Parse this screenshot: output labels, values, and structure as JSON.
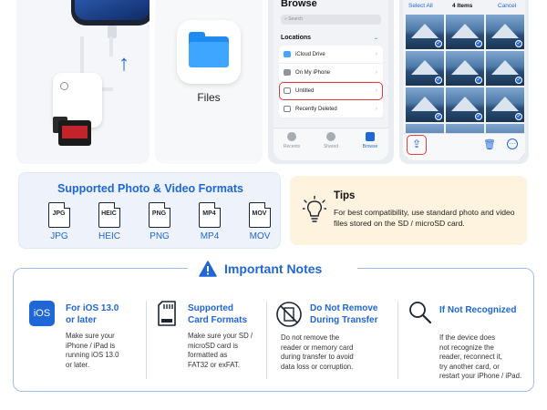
{
  "panel_files": {
    "label": "Files"
  },
  "browse": {
    "title": "Browse",
    "search_placeholder": "Search",
    "locations_header": "Locations",
    "items": [
      "iCloud Drive",
      "On My iPhone",
      "Untitled",
      "Recently Deleted"
    ],
    "tabs": [
      "Recents",
      "Shared",
      "Browse"
    ]
  },
  "photos": {
    "select_all": "Select All",
    "count": "4 Items",
    "cancel": "Cancel"
  },
  "formats": {
    "title": "Supported Photo & Video Formats",
    "items": [
      "JPG",
      "HEIC",
      "PNG",
      "MP4",
      "MOV"
    ]
  },
  "tips": {
    "title": "Tips",
    "text": "For best compatibility, use standard photo and video files stored on the SD / microSD card."
  },
  "notes": {
    "title": "Important Notes",
    "ios_badge": "iOS",
    "cards": [
      {
        "title_1": "For iOS 13.0",
        "title_2": "or later",
        "text_1": "Make sure your",
        "text_2": "iPhone / iPad is",
        "text_3": "running iOS 13.0",
        "text_4": "or later."
      },
      {
        "title_1": "Supported",
        "title_2": "Card Formats",
        "text_1": "Make sure your SD /",
        "text_2": "microSD card is",
        "text_3": "formatted as",
        "text_4": "FAT32 or exFAT."
      },
      {
        "title_1": "Do Not Remove",
        "title_2": "During Transfer",
        "text_1": "Do not remove the",
        "text_2": "reader or memory card",
        "text_3": "during transfer to avoid",
        "text_4": "data loss or corruption."
      },
      {
        "title_1": "If Not Recognized",
        "text_1": "If the device does",
        "text_2": "not recognize the",
        "text_3": "reader, reconnect it,",
        "text_4": "try another card, or",
        "text_5": "restart your iPhone / iPad."
      }
    ]
  },
  "colors": {
    "accent": "#1f66d6",
    "highlight": "#e23b3b",
    "tips_bg": "#fdf3df",
    "formats_bg": "#eef3fb"
  }
}
